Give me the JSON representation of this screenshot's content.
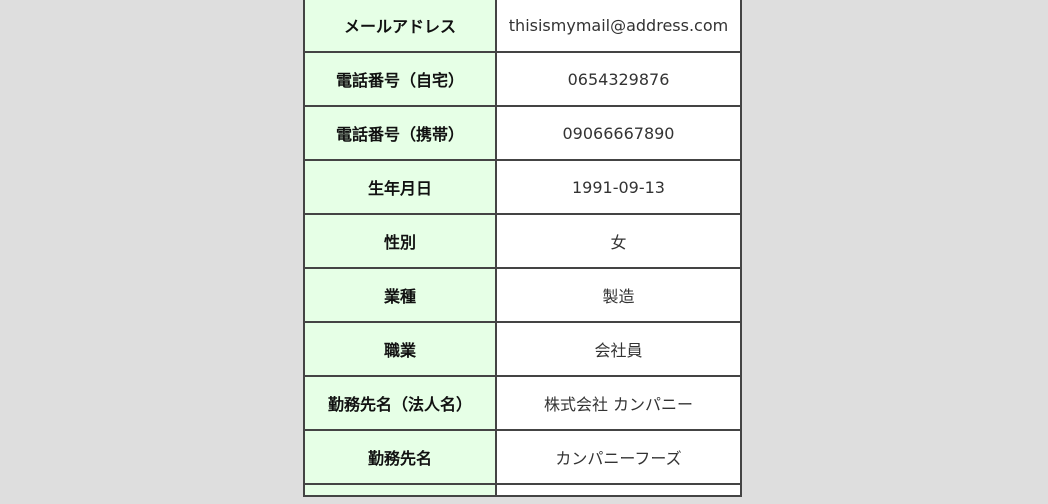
{
  "rows": [
    {
      "label": "メールアドレス",
      "value": "thisismymail@address.com"
    },
    {
      "label": "電話番号（自宅）",
      "value": "0654329876"
    },
    {
      "label": "電話番号（携帯）",
      "value": "09066667890"
    },
    {
      "label": "生年月日",
      "value": "1991-09-13"
    },
    {
      "label": "性別",
      "value": "女"
    },
    {
      "label": "業種",
      "value": "製造"
    },
    {
      "label": "職業",
      "value": "会社員"
    },
    {
      "label": "勤務先名（法人名）",
      "value": "株式会社 カンパニー"
    },
    {
      "label": "勤務先名",
      "value": "カンパニーフーズ"
    }
  ]
}
